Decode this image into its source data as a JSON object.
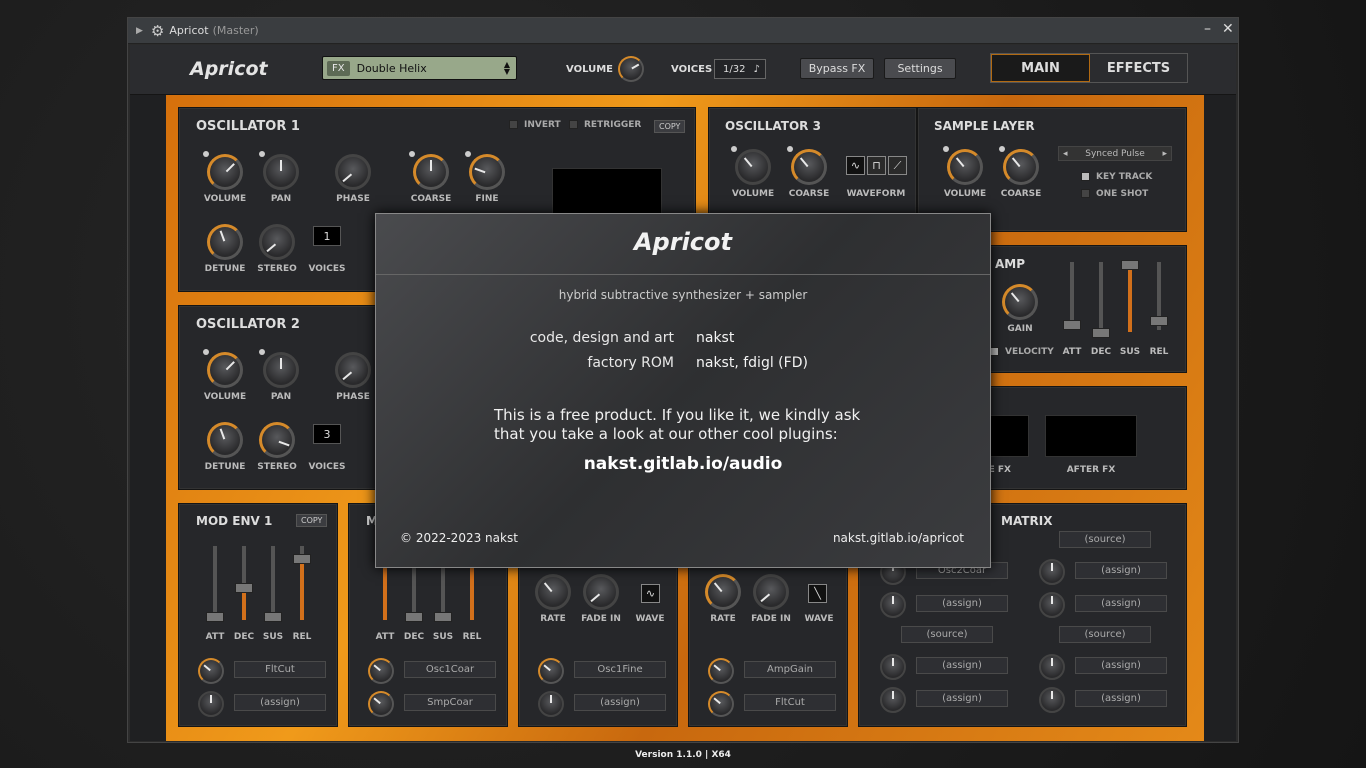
{
  "window": {
    "title": "Apricot",
    "subtitle": "(Master)"
  },
  "header": {
    "logo": "Apricot",
    "preset_tag": "FX",
    "preset_name": "Double Helix",
    "volume_label": "VOLUME",
    "voices_label": "VOICES",
    "voices_value": "1/32",
    "bypass_label": "Bypass FX",
    "settings_label": "Settings",
    "tabs": [
      "MAIN",
      "EFFECTS"
    ]
  },
  "osc1": {
    "title": "OSCILLATOR 1",
    "invert": "INVERT",
    "retrigger": "RETRIGGER",
    "copy": "COPY",
    "labels": [
      "VOLUME",
      "PAN",
      "PHASE",
      "COARSE",
      "FINE",
      "DETUNE",
      "STEREO",
      "VOICES"
    ],
    "voices": "1"
  },
  "osc2": {
    "title": "OSCILLATOR 2",
    "labels": [
      "VOLUME",
      "PAN",
      "PHASE",
      "DETUNE",
      "STEREO",
      "VOICES"
    ],
    "voices": "3"
  },
  "osc3": {
    "title": "OSCILLATOR 3",
    "labels": [
      "VOLUME",
      "COARSE",
      "WAVEFORM"
    ]
  },
  "sample": {
    "title": "SAMPLE LAYER",
    "labels": [
      "VOLUME",
      "COARSE"
    ],
    "selector": "Synced Pulse",
    "key_track": "KEY TRACK",
    "one_shot": "ONE SHOT"
  },
  "amp": {
    "title": "AMP",
    "gain": "GAIN",
    "velocity": "VELOCITY",
    "sliders": [
      "ATT",
      "DEC",
      "SUS",
      "REL"
    ]
  },
  "fx": {
    "pre": "PRE FX",
    "after": "AFTER FX"
  },
  "modenv1": {
    "title": "MOD ENV 1",
    "copy": "COPY",
    "sliders": [
      "ATT",
      "DEC",
      "SUS",
      "REL"
    ],
    "targets": [
      "FltCut",
      "(assign)"
    ]
  },
  "modenv2": {
    "title": "M",
    "sliders": [
      "ATT",
      "DEC",
      "SUS",
      "REL"
    ],
    "targets": [
      "Osc1Coar",
      "SmpCoar"
    ]
  },
  "lfo1": {
    "labels": [
      "RATE",
      "FADE IN",
      "WAVE"
    ],
    "targets": [
      "Osc1Fine",
      "(assign)"
    ]
  },
  "lfo2": {
    "labels": [
      "RATE",
      "FADE IN",
      "WAVE"
    ],
    "targets": [
      "AmpGain",
      "FltCut"
    ]
  },
  "matrix": {
    "title": "MATRIX",
    "left": [
      "Osc2Coar",
      "(assign)",
      "(source)",
      "(assign)",
      "(assign)"
    ],
    "right": [
      "(source)",
      "(assign)",
      "(assign)",
      "(source)",
      "(assign)",
      "(assign)"
    ]
  },
  "version": "Version 1.1.0 | X64",
  "about": {
    "title": "Apricot",
    "subtitle": "hybrid subtractive synthesizer + sampler",
    "credit1_key": "code, design and art",
    "credit1_val": "nakst",
    "credit2_key": "factory ROM",
    "credit2_val": "nakst, fdigl (FD)",
    "message_line1": "This is a free product. If you like it, we kindly ask",
    "message_line2": "that you take a look at our other cool plugins:",
    "url": "nakst.gitlab.io/audio",
    "copyright": "© 2022-2023 nakst",
    "homepage": "nakst.gitlab.io/apricot"
  },
  "colors": {
    "accent": "#e08a18",
    "panel": "#26272a"
  }
}
